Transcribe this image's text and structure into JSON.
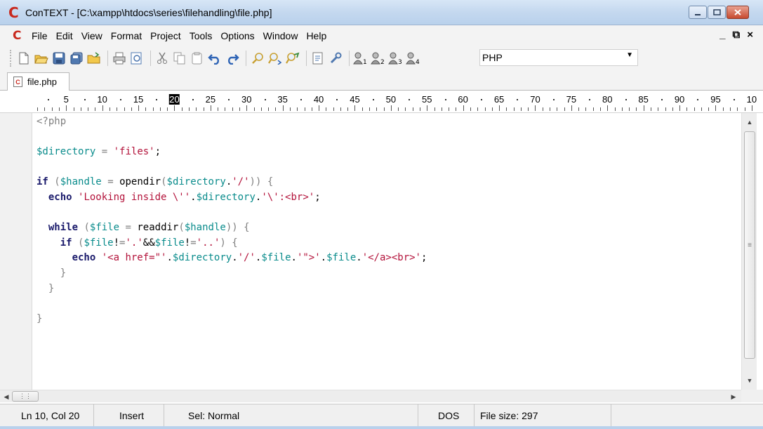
{
  "window": {
    "title": "ConTEXT - [C:\\xampp\\htdocs\\series\\filehandling\\file.php]",
    "app_logo": "C",
    "controls": [
      "minimize",
      "maximize",
      "close"
    ]
  },
  "menu": {
    "items": [
      "File",
      "Edit",
      "View",
      "Format",
      "Project",
      "Tools",
      "Options",
      "Window",
      "Help"
    ],
    "mdi_minimize": "_",
    "mdi_restore": "⧉",
    "mdi_close": "×"
  },
  "toolbar": {
    "buttons": [
      "new-file-icon",
      "open-file-icon",
      "save-icon",
      "save-all-icon",
      "open-folder-icon",
      "print-icon",
      "print-preview-icon",
      "cut-icon",
      "copy-icon",
      "paste-icon",
      "undo-icon",
      "redo-icon",
      "find-icon",
      "find-next-icon",
      "replace-icon",
      "file-properties-icon",
      "tools-icon",
      "user-command-1-icon",
      "user-command-2-icon",
      "user-command-3-icon",
      "user-command-4-icon"
    ],
    "highlighter": "PHP"
  },
  "tabs": [
    {
      "label": "file.php",
      "active": true
    }
  ],
  "ruler": {
    "labels": [
      "5",
      "10",
      "15",
      "20",
      "25",
      "30",
      "35",
      "40",
      "45",
      "50",
      "55",
      "60",
      "65",
      "70",
      "75",
      "80",
      "85",
      "90",
      "95",
      "10"
    ],
    "cursor_column": 20
  },
  "code": {
    "language": "PHP",
    "lines": [
      "<?php",
      "",
      "$directory = 'files';",
      "",
      "if ($handle = opendir($directory.'/')) {",
      "  echo 'Looking inside \\''.$directory.'\\':<br>';",
      "",
      "  while ($file = readdir($handle)) {",
      "    if ($file!='.'&&$file!='..') {",
      "      echo '<a href=\"'.$directory.'/'.$file.'\">'.$file.'</a><br>';",
      "    }",
      "  }",
      "",
      "}",
      "",
      "",
      "",
      "",
      "?>"
    ]
  },
  "status": {
    "position": "Ln 10, Col 20",
    "mode": "Insert",
    "selection": "Sel: Normal",
    "line_endings": "DOS",
    "file_size": "File size: 297"
  },
  "colors": {
    "keyword": "#1a1a6b",
    "variable": "#0a8c8c",
    "string": "#b3123a",
    "punctuation": "#808080"
  }
}
